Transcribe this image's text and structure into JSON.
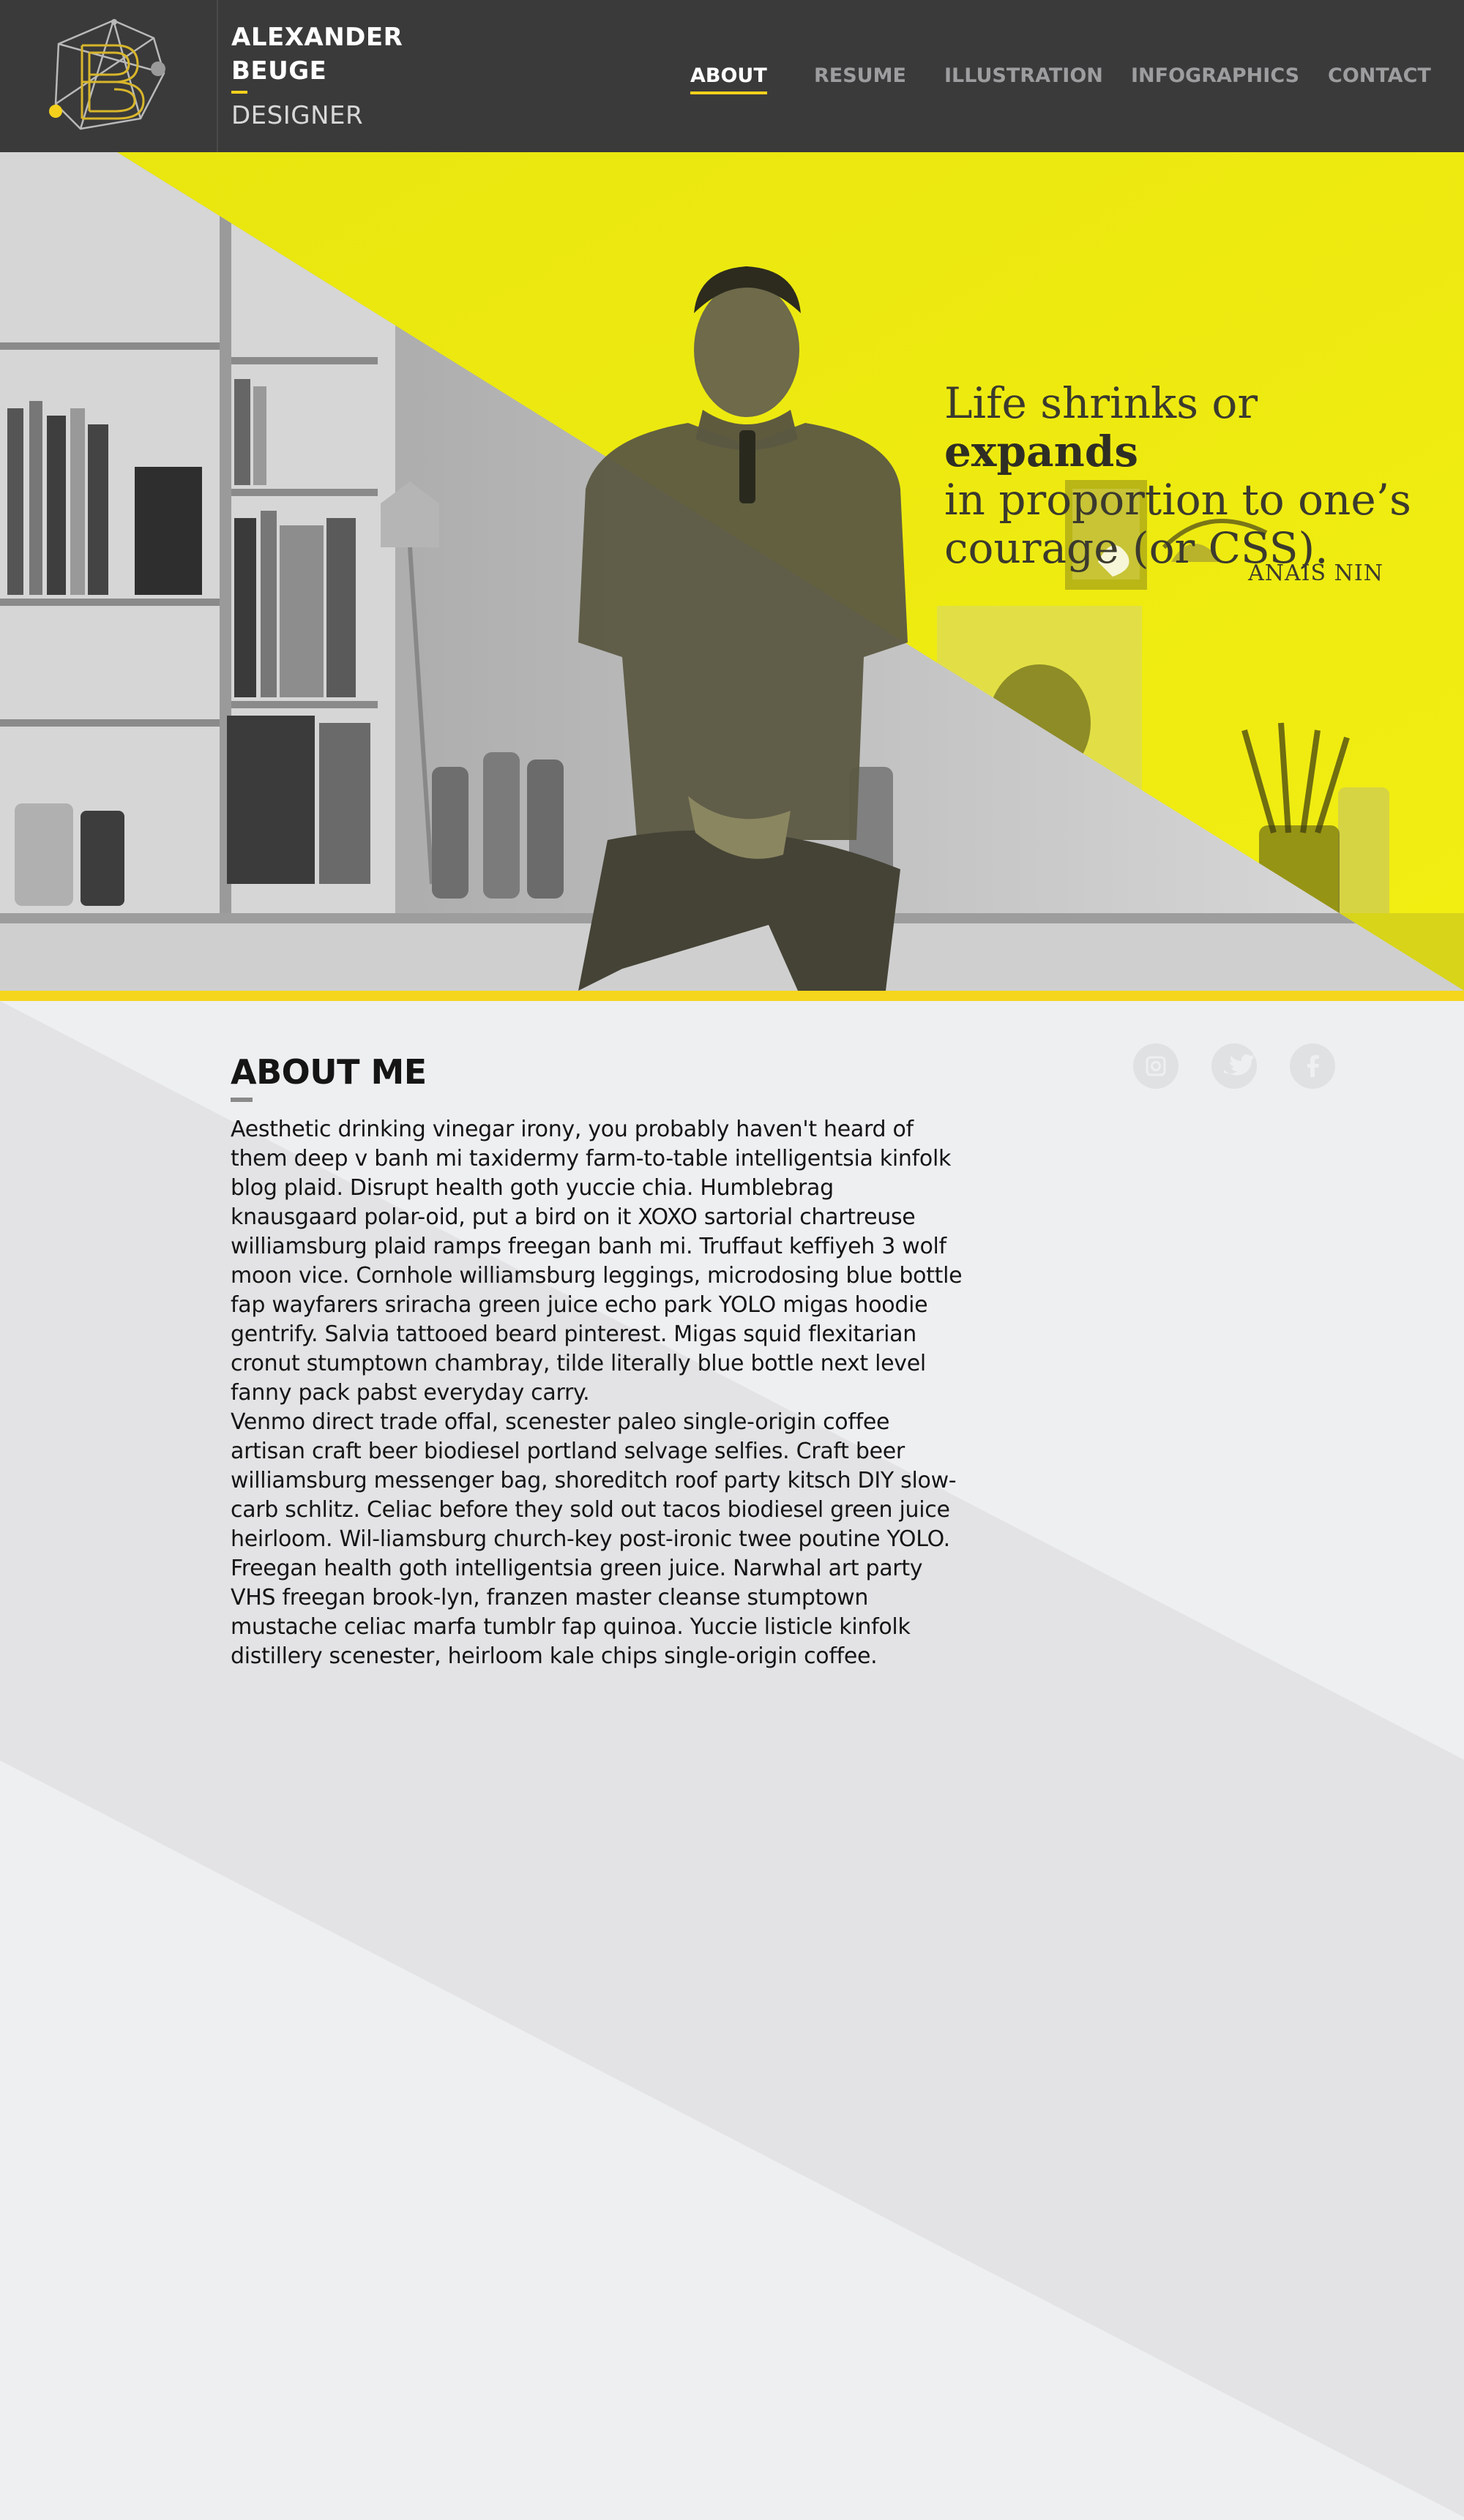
{
  "header": {
    "brand": {
      "name_line1": "ALEXANDER",
      "name_line2": "BEUGE",
      "role": "DESIGNER",
      "logo_icon": "monogram-b-logo"
    },
    "nav": [
      {
        "label": "ABOUT",
        "active": true
      },
      {
        "label": "RESUME",
        "active": false
      },
      {
        "label": "ILLUSTRATION",
        "active": false
      },
      {
        "label": "INFOGRAPHICS",
        "active": false
      },
      {
        "label": "CONTACT",
        "active": false
      }
    ]
  },
  "hero": {
    "quote": {
      "word1": "Life",
      "word2": "shrinks",
      "word3": "or",
      "word4": "expands",
      "line2": "in proportion to one’s",
      "line3": "courage (or CSS)."
    },
    "author": "ANAIS NIN",
    "photo": "portrait-in-studio"
  },
  "about": {
    "title": "ABOUT ME",
    "paragraphs": [
      "Aesthetic drinking vinegar irony, you probably haven't heard of them deep v banh mi taxidermy farm-to-table intelligentsia kinfolk blog plaid. Disrupt health goth yuccie chia. Humblebrag knausgaard polar-oid, put a bird on it XOXO sartorial chartreuse williamsburg plaid ramps freegan banh mi. Truffaut keffiyeh 3 wolf moon vice. Cornhole williamsburg leggings, microdosing blue bottle fap wayfarers sriracha green juice echo park YOLO migas hoodie gentrify. Salvia tattooed beard pinterest. Migas squid flexitarian cronut stumptown chambray, tilde literally blue bottle next level fanny pack pabst everyday carry.",
      "Venmo direct trade offal, scenester paleo single-origin coffee artisan craft beer biodiesel portland selvage selfies. Craft beer williamsburg messenger bag, shoreditch roof party kitsch DIY slow-carb schlitz. Celiac before they sold out tacos biodiesel green juice heirloom. Wil-liamsburg church-key post-ironic twee poutine YOLO. Freegan health goth intelligentsia green juice. Narwhal art party VHS freegan brook-lyn, franzen master cleanse stumptown mustache celiac marfa tumblr fap quinoa. Yuccie listicle kinfolk distillery scenester, heirloom kale chips single-origin coffee."
    ]
  },
  "social": [
    {
      "icon": "instagram-icon"
    },
    {
      "icon": "twitter-icon"
    },
    {
      "icon": "facebook-icon"
    }
  ],
  "colors": {
    "header_bg": "#3a3a3b",
    "accent_yellow": "#f4d01c",
    "hero_yellow": "#ecea10",
    "page_bg": "#eeeff1",
    "text": "#151515"
  }
}
